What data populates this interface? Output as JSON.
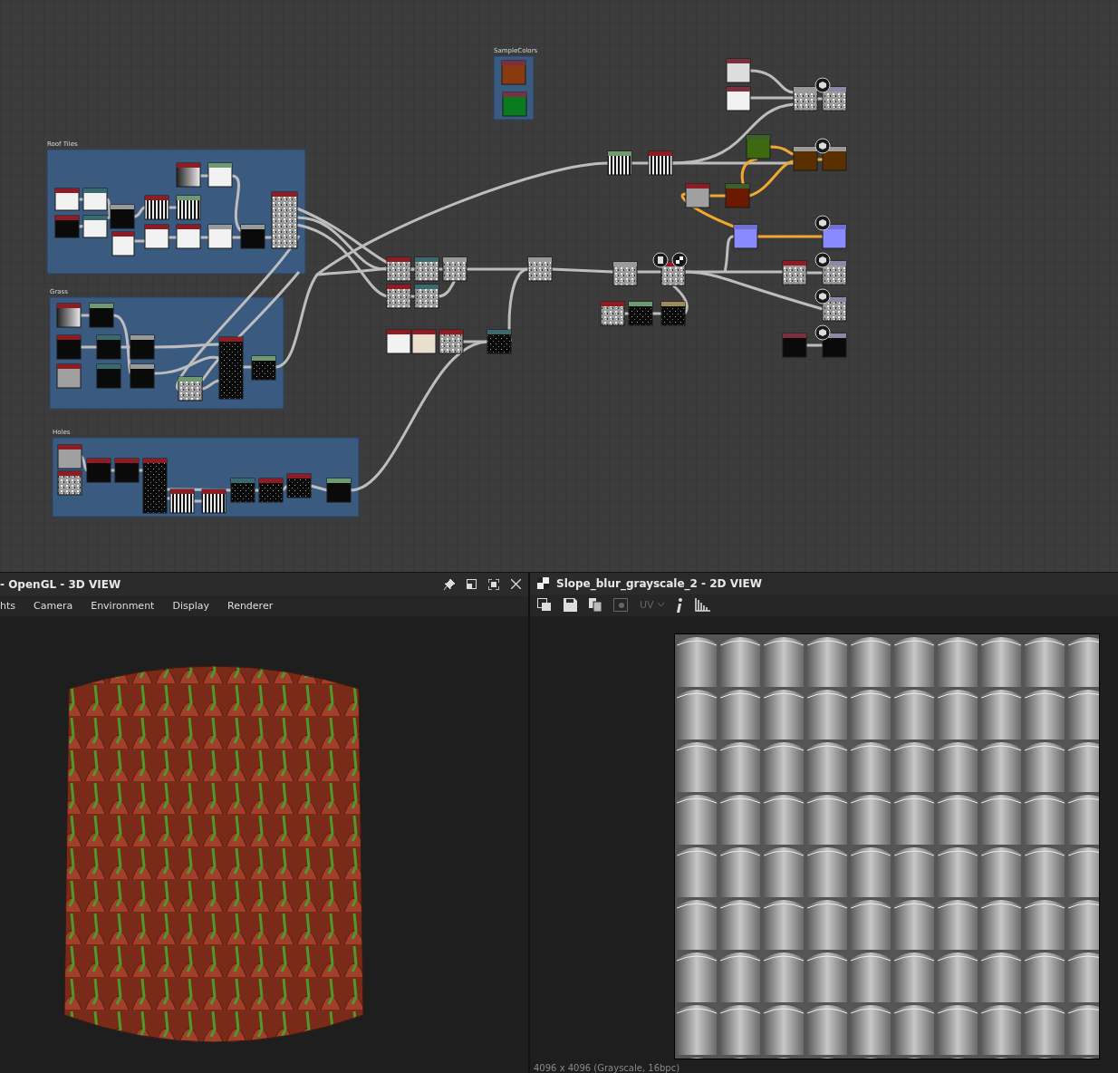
{
  "graph": {
    "frames": [
      {
        "title": "Roof Tiles"
      },
      {
        "title": "Grass"
      },
      {
        "title": "Holes"
      },
      {
        "title": "SampleColors"
      }
    ]
  },
  "view_3d": {
    "title": "- OpenGL - 3D VIEW",
    "menu": [
      "hts",
      "Camera",
      "Environment",
      "Display",
      "Renderer"
    ]
  },
  "view_2d": {
    "title": "Slope_blur_grayscale_2 - 2D VIEW",
    "uv": {
      "label": "UV",
      "disabled": true
    },
    "status": "4096 x 4096 (Grayscale, 16bpc)"
  }
}
